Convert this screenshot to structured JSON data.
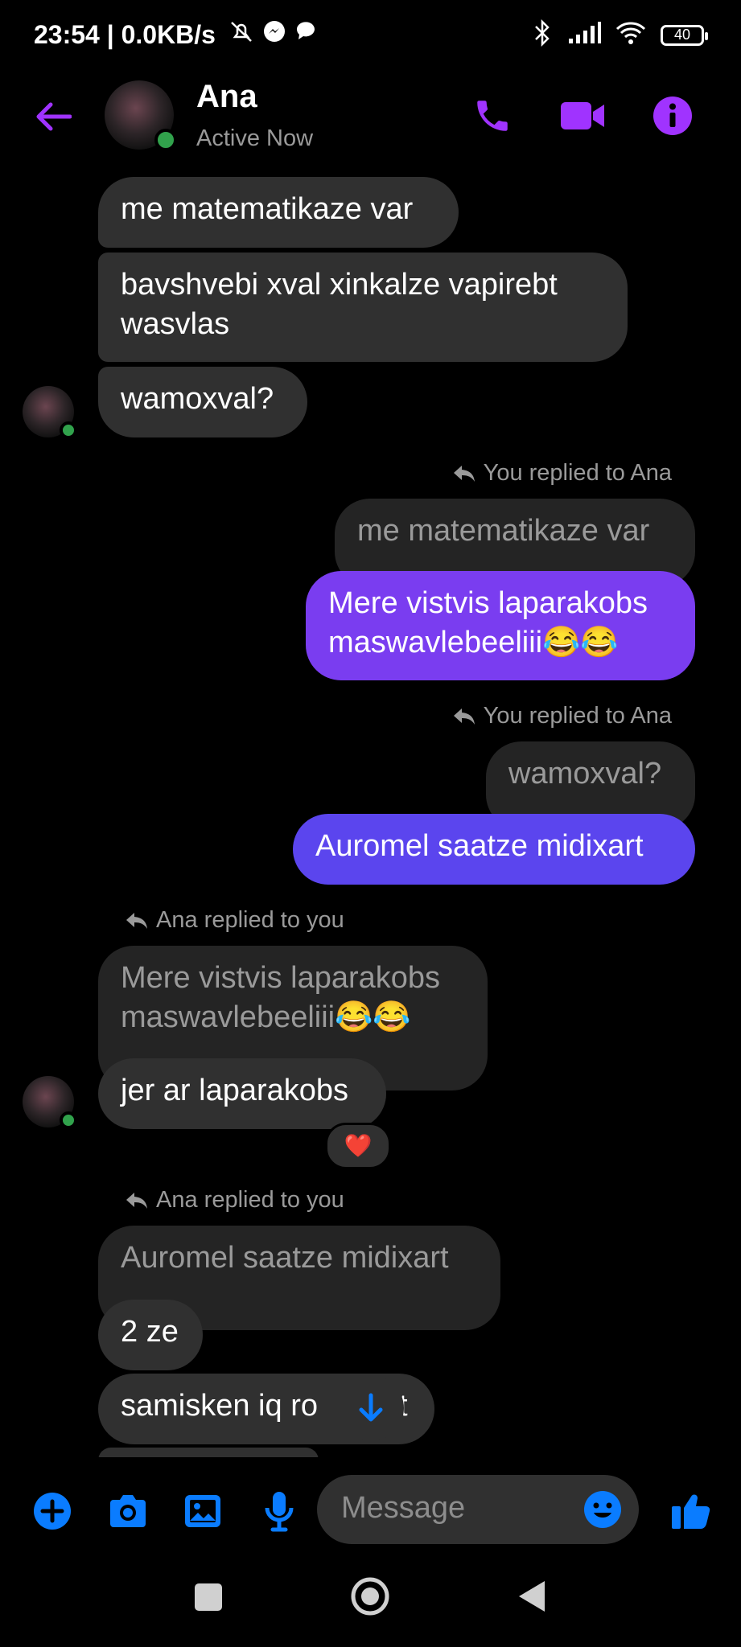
{
  "status_bar": {
    "left_text": "23:54 | 0.0KB/s",
    "battery": "40"
  },
  "header": {
    "contact_name": "Ana",
    "status": "Active Now"
  },
  "messages": {
    "m1": "me matematikaze var",
    "m2": "bavshvebi xval xinkalze vapirebt wasvlas",
    "m3": "wamoxval?",
    "r1_header": "You replied to Ana",
    "r1_quote": "me matematikaze var",
    "r1_text": "Mere vistvis laparakobs maswavlebeeliii😂😂",
    "r2_header": "You replied to Ana",
    "r2_quote": "wamoxval?",
    "r2_text": "Auromel saatze midixart",
    "r3_header": "Ana replied to you",
    "r3_quote": "Mere vistvis laparakobs maswavlebeeliii😂😂",
    "r3_text": "jer ar laparakobs",
    "r3_reaction": "❤️",
    "r4_header": "Ana replied to you",
    "r4_quote": "Auromel saatze midixart",
    "m4": "2 ze",
    "m5_a": "samisken iq ro",
    "m5_b": "t"
  },
  "composer": {
    "placeholder": "Message"
  },
  "colors": {
    "accent_purple": "#a033ff",
    "out_bubble_1": "#7a3df0",
    "out_bubble_2": "#5b45ee",
    "blue": "#0a7cff"
  }
}
